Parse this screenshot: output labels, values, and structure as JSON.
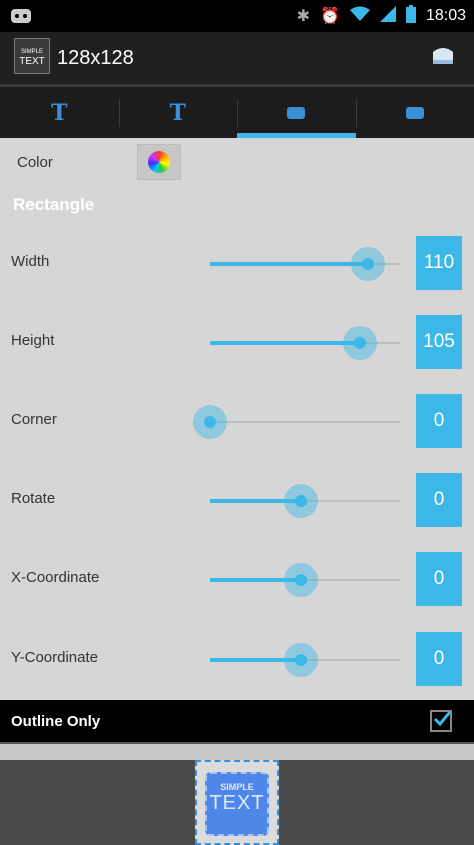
{
  "status_bar": {
    "time": "18:03"
  },
  "app": {
    "title": "128x128",
    "icon_line1": "SIMPLE",
    "icon_line2": "TEXT"
  },
  "tabs": [
    {
      "icon": "text-T-icon",
      "active": false
    },
    {
      "icon": "text-T-icon",
      "active": false
    },
    {
      "icon": "rectangle-icon",
      "active": true
    },
    {
      "icon": "rectangle-icon",
      "active": false
    }
  ],
  "color": {
    "label": "Color",
    "icon": "color-wheel-icon"
  },
  "section": {
    "title": "Rectangle"
  },
  "sliders": [
    {
      "label": "Width",
      "value": "110",
      "level": 0.83
    },
    {
      "label": "Height",
      "value": "105",
      "level": 0.79
    },
    {
      "label": "Corner",
      "value": "0",
      "level": 0.0
    },
    {
      "label": "Rotate",
      "value": "0",
      "level": 0.48
    },
    {
      "label": "X-Coordinate",
      "value": "0",
      "level": 0.48
    },
    {
      "label": "Y-Coordinate",
      "value": "0",
      "level": 0.48
    }
  ],
  "outline": {
    "label": "Outline Only",
    "checked": true
  },
  "preview": {
    "line1": "SIMPLE",
    "line2": "TEXT"
  },
  "colors": {
    "accent": "#3bb7e8",
    "panel": "#d6d6d6"
  }
}
